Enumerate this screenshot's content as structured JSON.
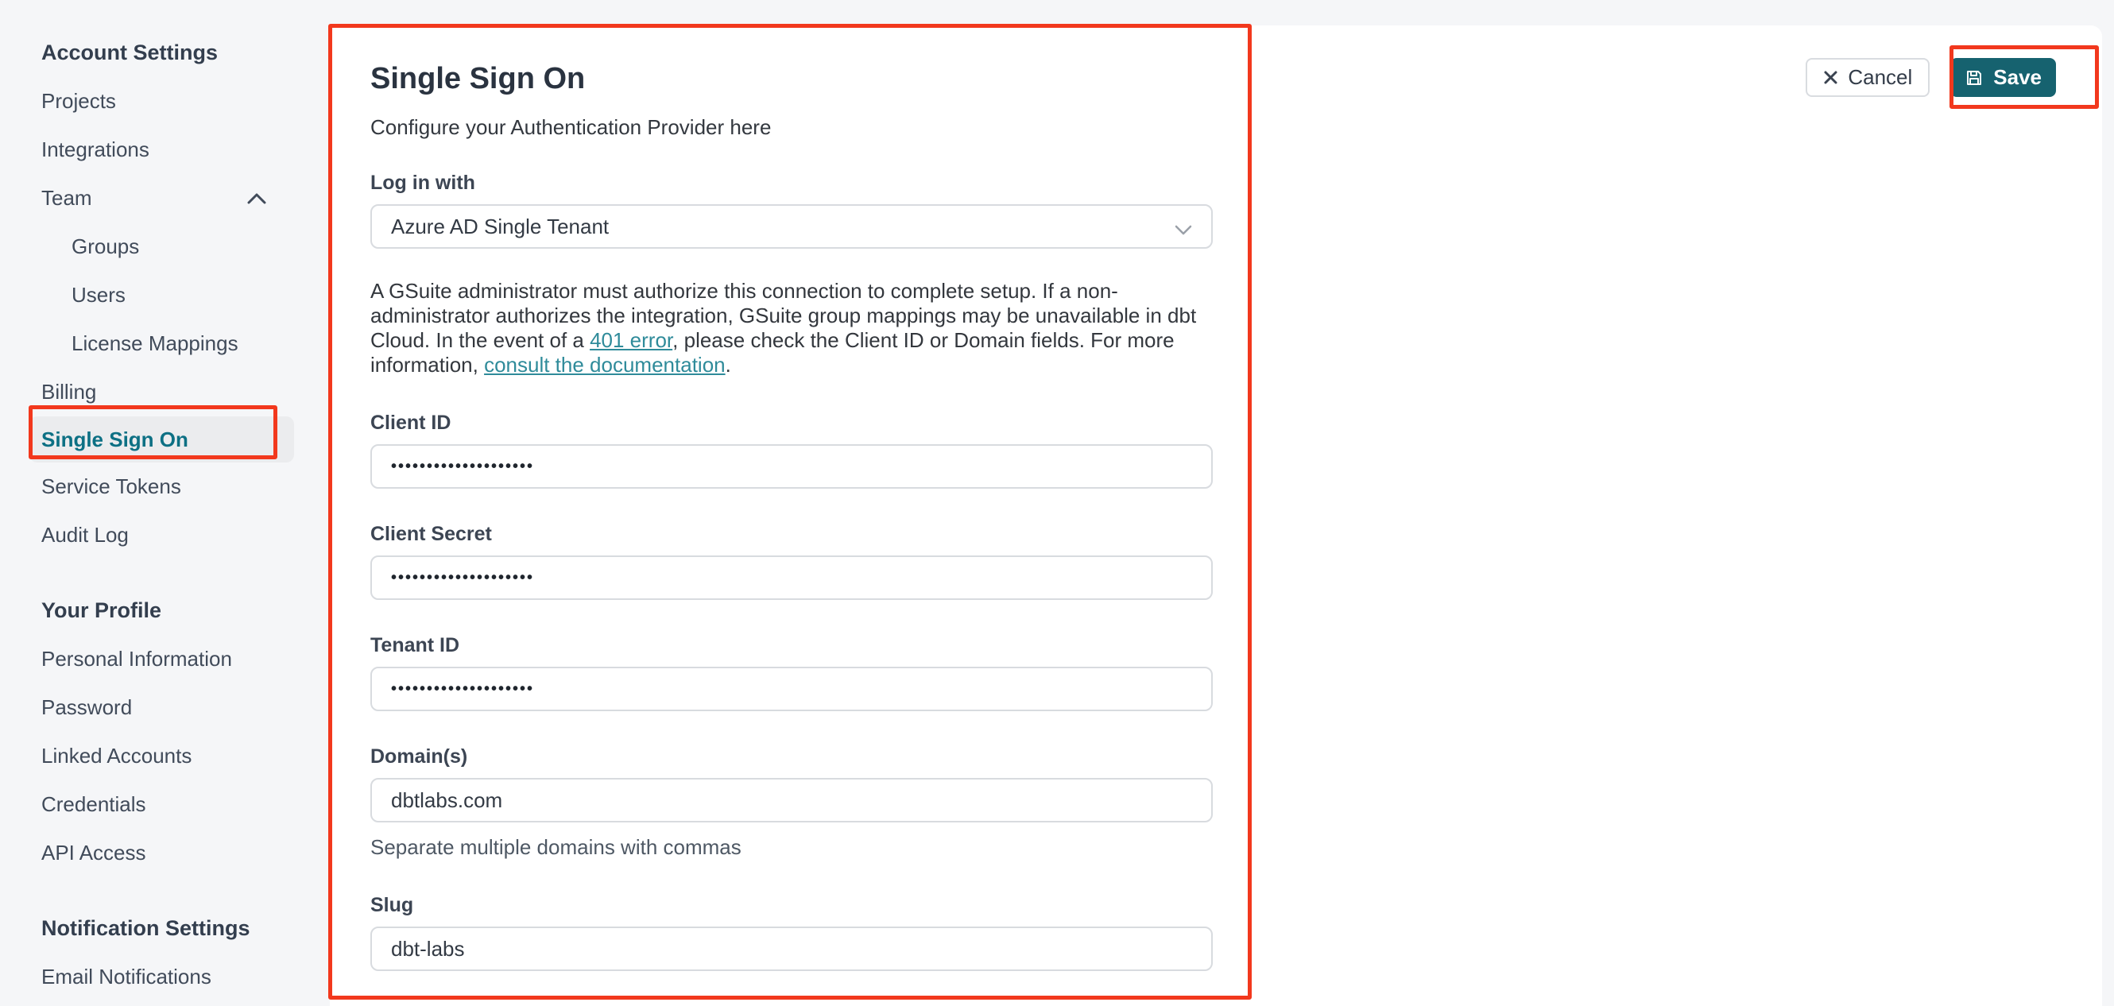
{
  "sidebar": {
    "sections": [
      {
        "header": "Account Settings",
        "items": [
          {
            "label": "Projects"
          },
          {
            "label": "Integrations"
          },
          {
            "label": "Team"
          },
          {
            "label": "Groups"
          },
          {
            "label": "Users"
          },
          {
            "label": "License Mappings"
          },
          {
            "label": "Billing"
          },
          {
            "label": "Single Sign On"
          },
          {
            "label": "Service Tokens"
          },
          {
            "label": "Audit Log"
          }
        ]
      },
      {
        "header": "Your Profile",
        "items": [
          {
            "label": "Personal Information"
          },
          {
            "label": "Password"
          },
          {
            "label": "Linked Accounts"
          },
          {
            "label": "Credentials"
          },
          {
            "label": "API Access"
          }
        ]
      },
      {
        "header": "Notification Settings",
        "items": [
          {
            "label": "Email Notifications"
          }
        ]
      }
    ]
  },
  "main": {
    "title": "Single Sign On",
    "subtitle": "Configure your Authentication Provider here"
  },
  "form": {
    "login": {
      "label": "Log in with",
      "value": "Azure AD Single Tenant"
    },
    "note": {
      "pre": "A GSuite administrator must authorize this connection to complete setup. If a non-administrator authorizes the integration, GSuite group mappings may be unavailable in dbt Cloud. In the event of a ",
      "link_401": "401 error",
      "mid": ", please check the Client ID or Domain fields. For more information, ",
      "link_docs": "consult the documentation",
      "post": "."
    },
    "client_id": {
      "label": "Client ID",
      "value": "••••••••••••••••••••"
    },
    "client_secret": {
      "label": "Client Secret",
      "value": "••••••••••••••••••••"
    },
    "tenant_id": {
      "label": "Tenant ID",
      "value": "••••••••••••••••••••"
    },
    "domains": {
      "label": "Domain(s)",
      "value": "dbtlabs.com",
      "helper": "Separate multiple domains with commas"
    },
    "slug": {
      "label": "Slug",
      "value": "dbt-labs"
    }
  },
  "actions": {
    "cancel": "Cancel",
    "save": "Save"
  },
  "icons": {
    "team_chevron": "chevron-up",
    "select_chevron": "chevron-down",
    "cancel": "x-mark",
    "save": "floppy-disk"
  },
  "colors": {
    "accent_teal": "#16626f",
    "active_item_teal": "#0d7084",
    "link_teal": "#2f8b9a",
    "annotation_red": "#f2381d",
    "page_background": "#f5f6f8",
    "card_background": "#ffffff"
  }
}
